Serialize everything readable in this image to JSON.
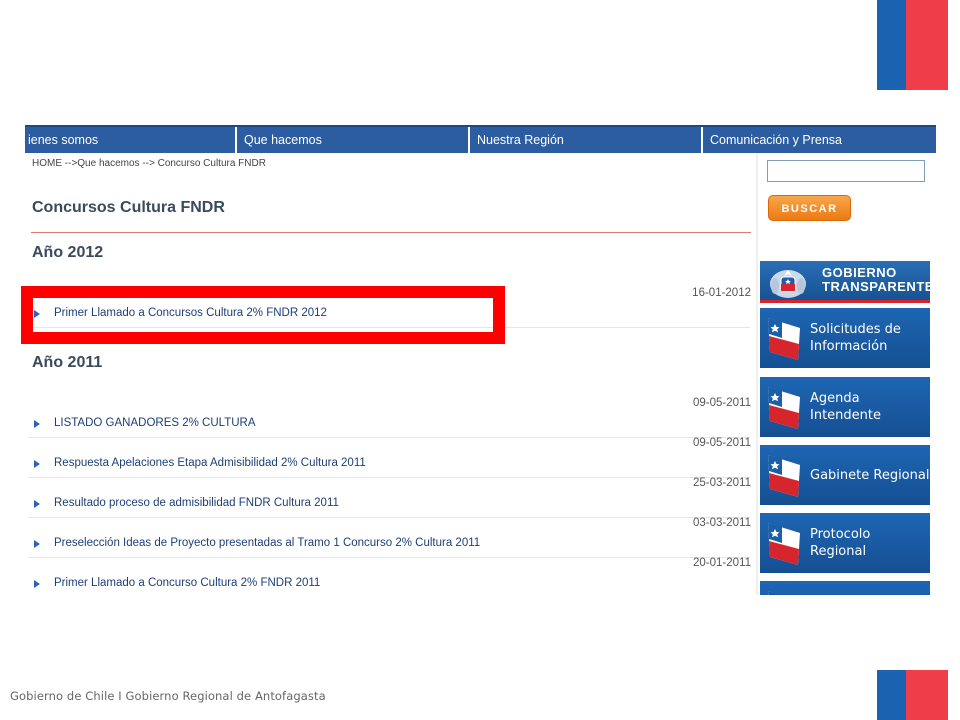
{
  "slide": {
    "footer": "Gobierno de Chile  I  Gobierno Regional de Antofagasta",
    "brand_colors": {
      "blue": "#1a63b0",
      "red": "#ef3e4a"
    }
  },
  "nav": {
    "items": [
      {
        "label": "ienes somos"
      },
      {
        "label": "Que hacemos"
      },
      {
        "label": "Nuestra Región"
      },
      {
        "label": "Comunicación y Prensa"
      }
    ]
  },
  "breadcrumb": "HOME -->Que hacemos --> Concurso Cultura FNDR",
  "page_title": "Concursos Cultura FNDR",
  "sections": [
    {
      "year": "Año 2012",
      "items": [
        {
          "date": "16-01-2012",
          "title": "Primer Llamado a Concursos Cultura 2% FNDR 2012"
        }
      ]
    },
    {
      "year": "Año 2011",
      "items": [
        {
          "date": "09-05-2011",
          "title": "LISTADO GANADORES 2% CULTURA"
        },
        {
          "date": "09-05-2011",
          "title": "Respuesta Apelaciones Etapa Admisibilidad 2% Cultura 2011"
        },
        {
          "date": "25-03-2011",
          "title": "Resultado proceso de admisibilidad FNDR Cultura 2011"
        },
        {
          "date": "03-03-2011",
          "title": "Preselección Ideas de Proyecto presentadas al Tramo 1 Concurso 2% Cultura 2011"
        },
        {
          "date": "20-01-2011",
          "title": "Primer Llamado a Concurso Cultura 2% FNDR 2011"
        }
      ]
    }
  ],
  "sidebar": {
    "search": {
      "value": "",
      "button": "BUSCAR"
    },
    "gobierno_transparente": {
      "line1": "GOBIERNO",
      "line2": "TRANSPARENTE"
    },
    "banners": [
      {
        "line1": "Solicitudes de",
        "line2": "Información"
      },
      {
        "line1": "Agenda Intendente",
        "line2": ""
      },
      {
        "line1": "Gabinete Regional",
        "line2": ""
      },
      {
        "line1": "Protocolo Regional",
        "line2": ""
      },
      {
        "line1": "",
        "line2": ""
      }
    ]
  },
  "annotation": {
    "highlight_color": "#ff0000"
  }
}
